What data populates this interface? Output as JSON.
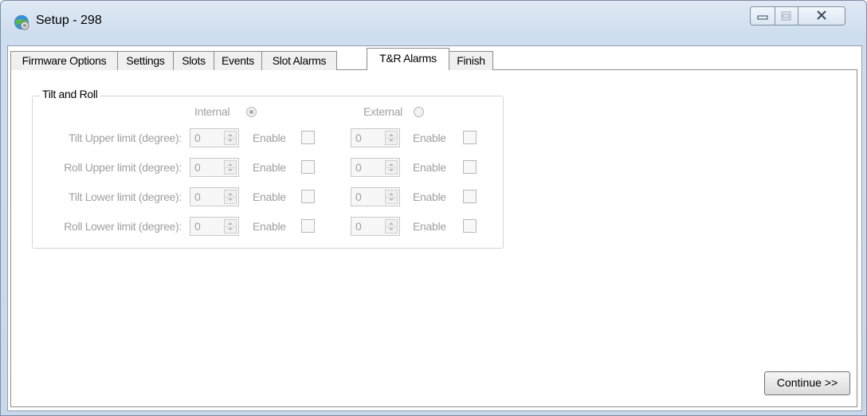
{
  "window": {
    "title": "Setup - 298",
    "icons": {
      "app": "globe-gear-icon",
      "minimize": "minimize-icon",
      "maximize": "maximize-icon",
      "close": "close-icon"
    }
  },
  "tabs": [
    {
      "label": "Firmware Options",
      "active": false
    },
    {
      "label": "Settings",
      "active": false
    },
    {
      "label": "Slots",
      "active": false
    },
    {
      "label": "Events",
      "active": false
    },
    {
      "label": "Slot Alarms",
      "active": false
    },
    {
      "label": "T&R Alarms",
      "active": true
    },
    {
      "label": "Finish",
      "active": false
    }
  ],
  "group": {
    "title": "Tilt and Roll",
    "internal_label": "Internal",
    "internal_selected": true,
    "external_label": "External",
    "external_selected": false,
    "rows": [
      {
        "label": "Tilt Upper limit (degree):",
        "internal_value": "0",
        "internal_enable": "Enable",
        "external_value": "0",
        "external_enable": "Enable"
      },
      {
        "label": "Roll Upper limit (degree):",
        "internal_value": "0",
        "internal_enable": "Enable",
        "external_value": "0",
        "external_enable": "Enable"
      },
      {
        "label": "Tilt Lower limit (degree):",
        "internal_value": "0",
        "internal_enable": "Enable",
        "external_value": "0",
        "external_enable": "Enable"
      },
      {
        "label": "Roll Lower limit (degree):",
        "internal_value": "0",
        "internal_enable": "Enable",
        "external_value": "0",
        "external_enable": "Enable"
      }
    ]
  },
  "buttons": {
    "continue": "Continue >>"
  },
  "colors": {
    "disabled_text": "#a0a0a0",
    "frame": "#c7d8ea"
  }
}
